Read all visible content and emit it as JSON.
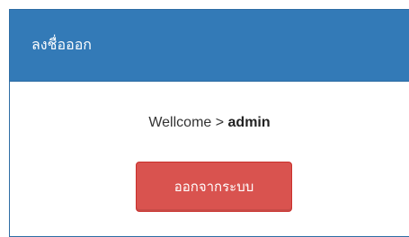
{
  "panel": {
    "title": "ลงชื่อออก",
    "welcome_prefix": "Wellcome > ",
    "username": "admin",
    "logout_label": "ออกจากระบบ"
  },
  "colors": {
    "heading_bg": "#337ab7",
    "button_bg": "#d9534f",
    "text": "#333333"
  }
}
